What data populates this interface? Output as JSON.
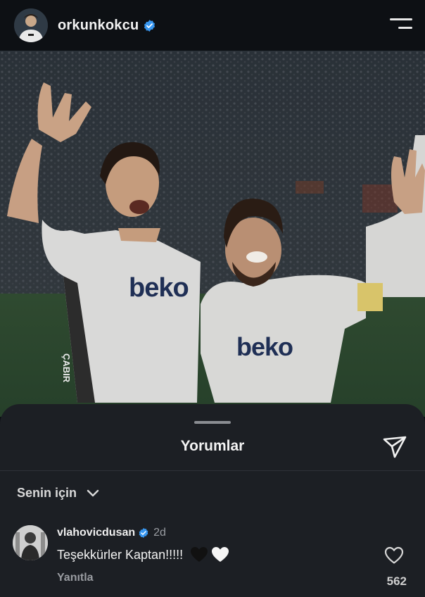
{
  "header": {
    "username": "orkunkokcu",
    "verified_icon": "verified-badge-icon",
    "menu_icon": "hamburger-menu-icon"
  },
  "photo": {
    "jersey_text_left": "beko",
    "jersey_text_right": "beko",
    "sleeve_text": "ÇABIR"
  },
  "comments_sheet": {
    "title": "Yorumlar",
    "share_icon": "send-icon",
    "sort_label": "Senin için",
    "sort_icon": "chevron-down-icon",
    "comments": [
      {
        "username": "vlahovicdusan",
        "verified": true,
        "time": "2d",
        "text": "Teşekkürler Kaptan!!!!!",
        "emojis": [
          "black-heart",
          "white-heart"
        ],
        "reply_label": "Yanıtla",
        "like_count": "562"
      }
    ]
  },
  "colors": {
    "background": "#0c0f14",
    "sheet": "#1c1f24",
    "verified_blue": "#3897f0",
    "muted_text": "#9a9da2"
  }
}
